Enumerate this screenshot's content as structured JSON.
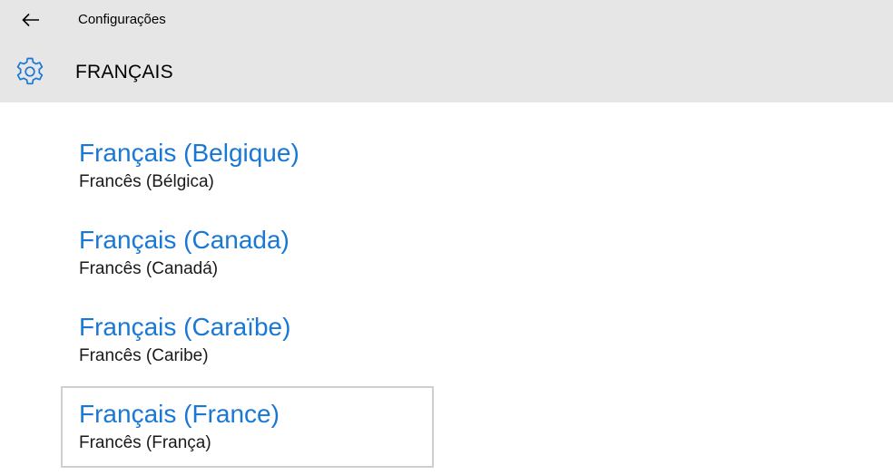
{
  "header": {
    "back_icon": "arrow-left-icon",
    "app_title": "Configurações",
    "settings_icon": "gear-icon",
    "page_title": "FRANÇAIS"
  },
  "colors": {
    "header_bg": "#e6e6e6",
    "accent": "#1878d4",
    "selected_border": "#cfcfcf"
  },
  "languages": [
    {
      "name": "Français (Belgique)",
      "translation": "Francês (Bélgica)",
      "selected": false
    },
    {
      "name": "Français (Canada)",
      "translation": "Francês (Canadá)",
      "selected": false
    },
    {
      "name": "Français (Caraïbe)",
      "translation": "Francês (Caribe)",
      "selected": false
    },
    {
      "name": "Français (France)",
      "translation": "Francês (França)",
      "selected": true
    }
  ]
}
